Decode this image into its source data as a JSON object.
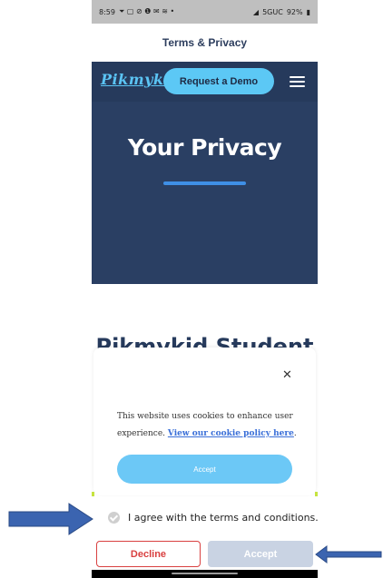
{
  "status_bar": {
    "time": "8:59",
    "left_icons": "⏷ ▢ ⊘ ❶ ✉ ≋ •",
    "network": "5GUC",
    "battery": "92%"
  },
  "page": {
    "title": "Terms & Privacy"
  },
  "site_header": {
    "logo_text": "Pikmykid",
    "demo_button_label": "Request a Demo",
    "menu_icon": "hamburger-icon"
  },
  "hero": {
    "title": "Your Privacy"
  },
  "section": {
    "title": "Pikmykid Student"
  },
  "cookie_banner": {
    "text_prefix": "This website uses cookies to enhance user experience. ",
    "link_text": "View our cookie policy here",
    "text_suffix": ".",
    "accept_label": "Accept",
    "close_icon": "close-icon"
  },
  "consent": {
    "agree_label": "I agree with the terms and conditions.",
    "decline_label": "Decline",
    "accept_label": "Accept"
  },
  "colors": {
    "header_navy": "#263a5c",
    "accent_blue": "#5cc8f5",
    "decline_red": "#d94040",
    "disabled_accept": "#c9d3e3",
    "annotation_arrow": "#3b64b0"
  }
}
